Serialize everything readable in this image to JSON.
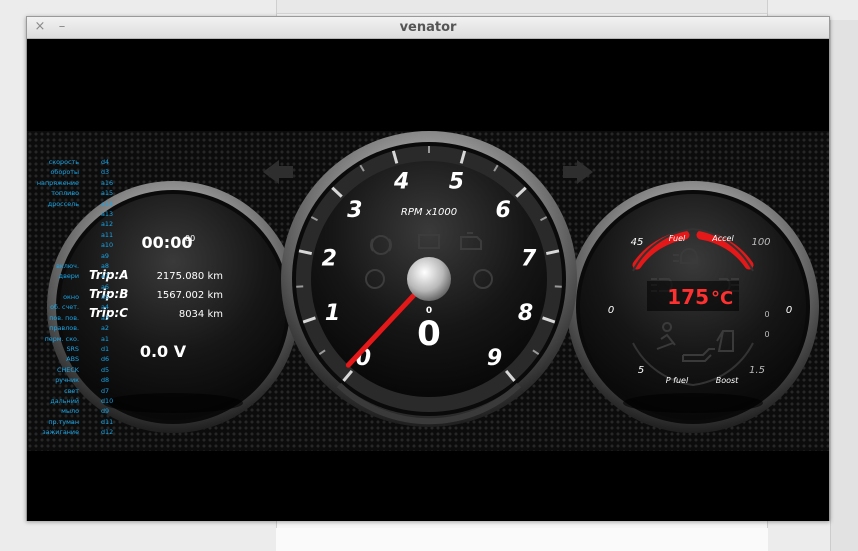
{
  "window": {
    "title": "venator",
    "close_glyph": "×",
    "minimize_glyph": "–"
  },
  "colors": {
    "accent_red": "#e41818",
    "temp_red": "#ff3030",
    "label_blue": "#19a6e8",
    "chrome": "#c8c8c8"
  },
  "left_gauge": {
    "clock": "00:00",
    "clock_seconds": "00",
    "trips": [
      {
        "label": "Trip:A",
        "value": "2175.080 km"
      },
      {
        "label": "Trip:B",
        "value": "1567.002 km"
      },
      {
        "label": "Trip:C",
        "value": "8034 km"
      }
    ],
    "voltage": "0.0 V"
  },
  "tachometer": {
    "unit_label": "RPM x1000",
    "scale": [
      "0",
      "1",
      "2",
      "3",
      "4",
      "5",
      "6",
      "7",
      "8",
      "9"
    ],
    "rpm_thousands": 0.1,
    "gear_small": "0",
    "speed": "0",
    "warning_icons": [
      "brake-warning-icon",
      "battery-icon",
      "check-engine-icon",
      "srs-icon",
      "abs-icon"
    ]
  },
  "right_gauge": {
    "labels": {
      "fuel": "Fuel",
      "accel": "Accel",
      "pfuel": "P fuel",
      "boost": "Boost"
    },
    "scale": {
      "top_left": "45",
      "top_right": "100",
      "left": "0",
      "right": "0",
      "bottom_left": "5",
      "bottom_right": "1.5",
      "inner_right_1": "0",
      "inner_right_2": "0"
    },
    "temperature": "175",
    "temperature_unit": "°C",
    "fuel_level": 0.55,
    "accel_level": 0.5,
    "icons": [
      "fog-light-icon",
      "front-fog-icon",
      "headlight-icon",
      "seatbelt-icon",
      "oil-can-icon",
      "door-open-icon"
    ]
  },
  "indicators": {
    "labels": [
      "скорость",
      "обороты",
      "напряжение",
      "топливо",
      "дроссель",
      "",
      "",
      "",
      "",
      "",
      "включ.",
      "двери",
      "",
      "окно",
      "об. счет.",
      "пов. пов.",
      "правлов.",
      "перм. ско.",
      "SRS",
      "ABS",
      "CHECK",
      "ручник",
      "свет",
      "дальний",
      "мыло",
      "пр.туман",
      "зажигание"
    ],
    "codes": [
      "d4",
      "d3",
      "a16",
      "a15",
      "a14",
      "a13",
      "a12",
      "a11",
      "a10",
      "a9",
      "a8",
      "a7",
      "a6",
      "a5",
      "a4",
      "a3",
      "a2",
      "a1",
      "d1",
      "d6",
      "d5",
      "d8",
      "d7",
      "d10",
      "d9",
      "d11",
      "d12"
    ]
  }
}
